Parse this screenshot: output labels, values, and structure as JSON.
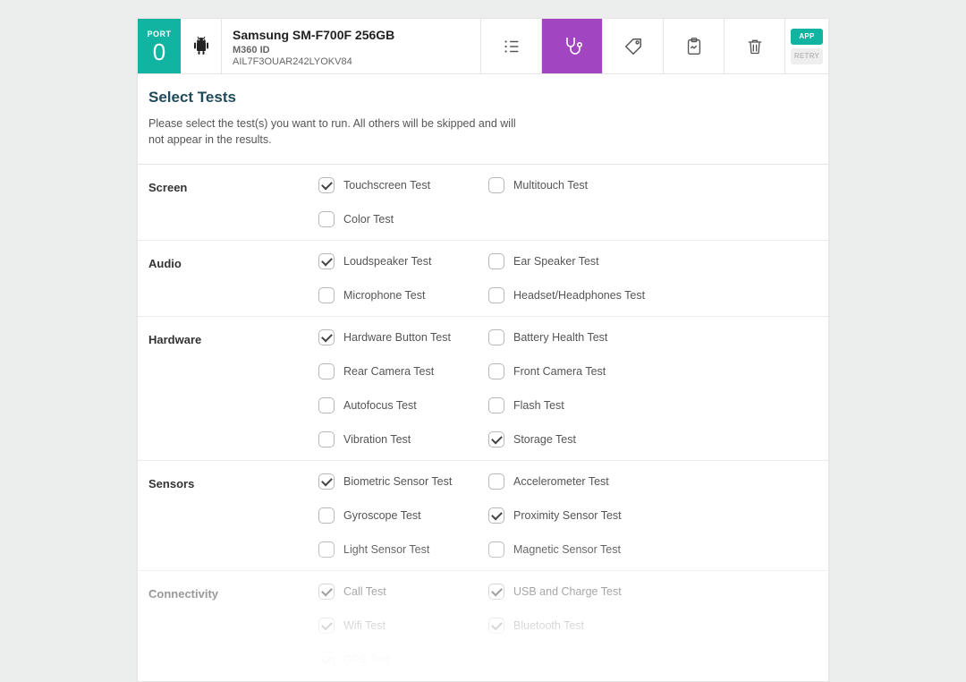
{
  "header": {
    "port_label": "PORT",
    "port_number": "0",
    "device_name": "Samsung SM-F700F 256GB",
    "m360_label": "M360 ID",
    "m360_id": "AIL7F3OUAR242LYOKV84",
    "app_btn": "APP",
    "retry_btn": "RETRY"
  },
  "intro": {
    "title": "Select Tests",
    "instructions": "Please select the test(s) you want to run. All others will be skipped and will not appear in the results."
  },
  "groups": [
    {
      "label": "Screen",
      "tests": [
        {
          "label": "Touchscreen Test",
          "checked": true
        },
        {
          "label": "Multitouch Test",
          "checked": false
        },
        {
          "label": "Color Test",
          "checked": false
        }
      ]
    },
    {
      "label": "Audio",
      "tests": [
        {
          "label": "Loudspeaker Test",
          "checked": true
        },
        {
          "label": "Ear Speaker Test",
          "checked": false
        },
        {
          "label": "Microphone Test",
          "checked": false
        },
        {
          "label": "Headset/Headphones Test",
          "checked": false
        }
      ]
    },
    {
      "label": "Hardware",
      "tests": [
        {
          "label": "Hardware Button Test",
          "checked": true
        },
        {
          "label": "Battery Health Test",
          "checked": false
        },
        {
          "label": "Rear Camera Test",
          "checked": false
        },
        {
          "label": "Front Camera Test",
          "checked": false
        },
        {
          "label": "Autofocus Test",
          "checked": false
        },
        {
          "label": "Flash Test",
          "checked": false
        },
        {
          "label": "Vibration Test",
          "checked": false
        },
        {
          "label": "Storage Test",
          "checked": true
        }
      ]
    },
    {
      "label": "Sensors",
      "tests": [
        {
          "label": "Biometric Sensor Test",
          "checked": true
        },
        {
          "label": "Accelerometer Test",
          "checked": false
        },
        {
          "label": "Gyroscope Test",
          "checked": false
        },
        {
          "label": "Proximity Sensor Test",
          "checked": true
        },
        {
          "label": "Light Sensor Test",
          "checked": false
        },
        {
          "label": "Magnetic Sensor Test",
          "checked": false
        }
      ]
    },
    {
      "label": "Connectivity",
      "tests": [
        {
          "label": "Call Test",
          "checked": true
        },
        {
          "label": "USB and Charge Test",
          "checked": true
        },
        {
          "label": "Wifi Test",
          "checked": true
        },
        {
          "label": "Bluetooth Test",
          "checked": true
        },
        {
          "label": "GPS Test",
          "checked": true
        }
      ]
    }
  ]
}
